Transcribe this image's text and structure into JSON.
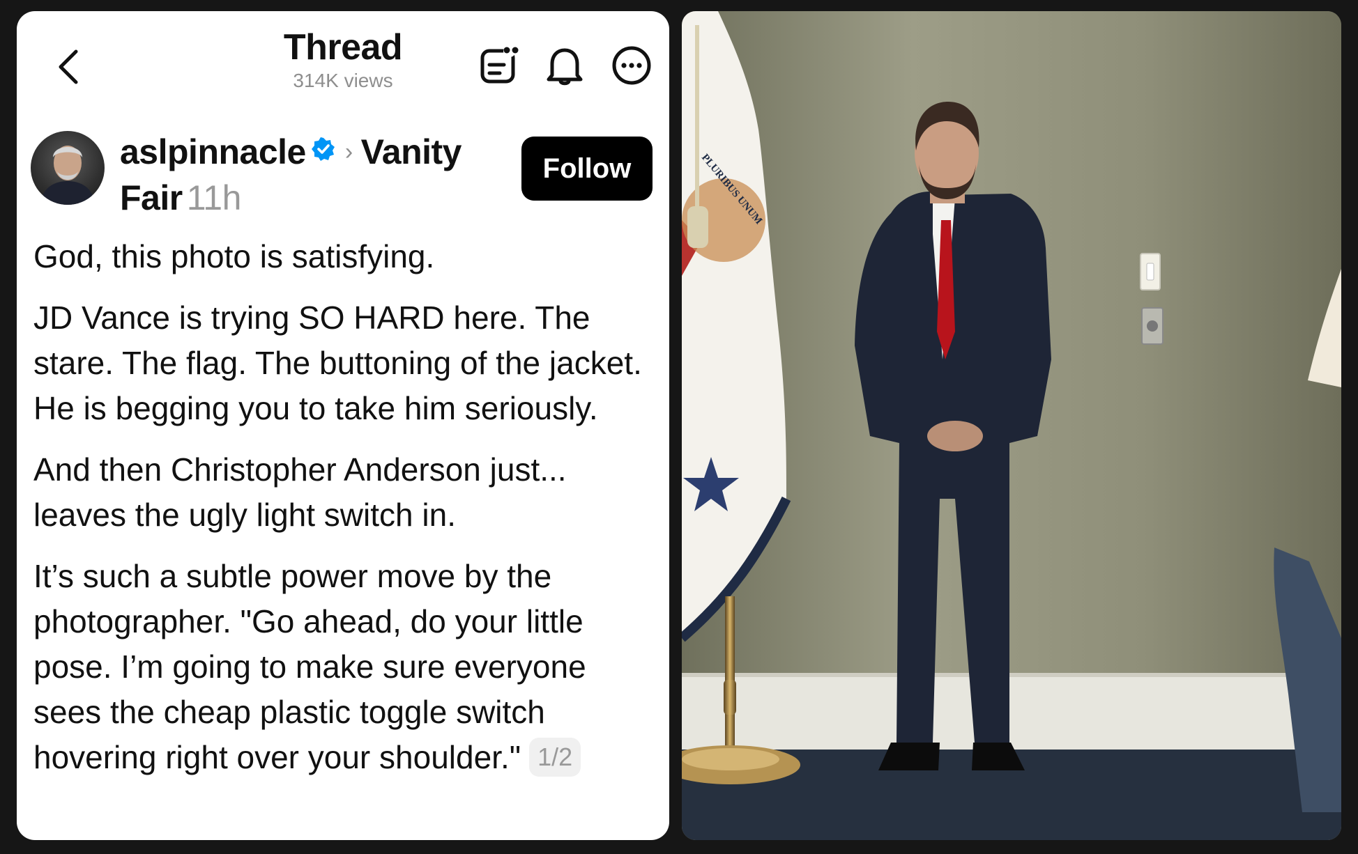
{
  "header": {
    "title": "Thread",
    "views": "314K views"
  },
  "post": {
    "username": "aslpinnacle",
    "separator": "›",
    "community": "Vanity Fair",
    "time": "11h",
    "follow_label": "Follow",
    "paragraphs": [
      "God, this photo is satisfying.",
      "JD Vance is trying SO HARD here. The stare. The flag. The buttoning of the jacket. He is begging you to take him seriously.",
      "And then Christopher Anderson just... leaves the ugly light switch in.",
      "It’s such a subtle power move by the photographer. \"Go ahead, do your little pose. I’m going to make sure everyone sees the cheap plastic toggle switch hovering right over your shoulder.\""
    ],
    "page_indicator": "1/2"
  },
  "photo": {
    "flag_text": "PLURIBUS UNUM"
  },
  "colors": {
    "verified_badge": "#0095f6",
    "follow_button": "#000000",
    "page_background": "#161616"
  }
}
